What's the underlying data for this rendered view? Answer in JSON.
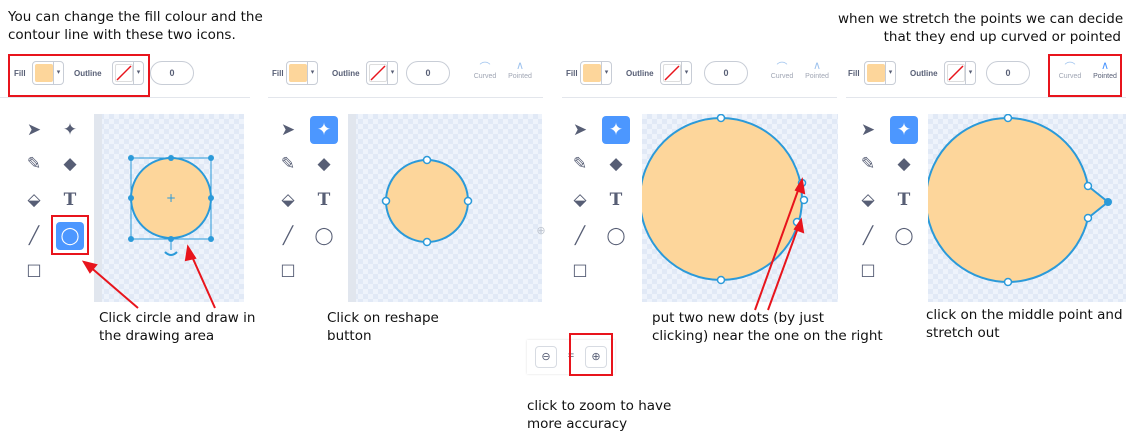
{
  "captions": {
    "top_left": [
      "You can change the fill colour and the",
      "contour line with these two icons."
    ],
    "top_right": [
      "when we stretch the points we can decide",
      "that they end up curved or pointed"
    ],
    "step1": [
      "Click circle and draw in",
      "the drawing area"
    ],
    "step2": [
      "Click on reshape",
      "button"
    ],
    "step3": [
      "put two new dots (by just",
      "clicking) near the one on the right"
    ],
    "step4": [
      "click on the middle point and",
      "stretch out"
    ],
    "zoom": [
      "click to zoom to have",
      "more accuracy"
    ]
  },
  "toolbar": {
    "fill_label": "Fill",
    "outline_label": "Outline",
    "outline_width": "0",
    "curved_label": "Curved",
    "pointed_label": "Pointed",
    "fill_color": "#fdd69b"
  },
  "tools": [
    {
      "name": "select",
      "icon": "arrow-icon"
    },
    {
      "name": "reshape",
      "icon": "reshape-icon"
    },
    {
      "name": "brush",
      "icon": "brush-icon"
    },
    {
      "name": "eraser",
      "icon": "eraser-icon"
    },
    {
      "name": "fill",
      "icon": "bucket-icon"
    },
    {
      "name": "text",
      "icon": "text-icon"
    },
    {
      "name": "line",
      "icon": "line-icon"
    },
    {
      "name": "circle",
      "icon": "circle-icon"
    },
    {
      "name": "rectangle",
      "icon": "rectangle-icon"
    }
  ],
  "colors": {
    "accent": "#4c97ff",
    "highlight": "#e8141c",
    "stroke": "#2b9ad9",
    "fill": "#fdd69b"
  }
}
